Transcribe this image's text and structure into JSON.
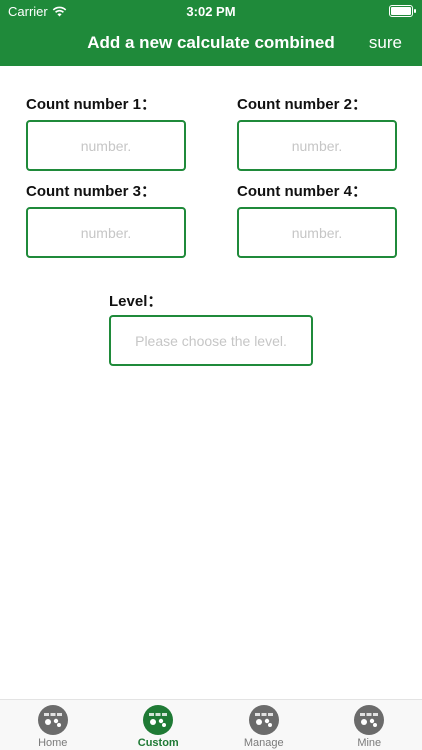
{
  "status_bar": {
    "carrier": "Carrier",
    "time": "3:02 PM"
  },
  "nav": {
    "title": "Add a new calculate combined",
    "sure_label": "sure"
  },
  "form": {
    "fields": [
      {
        "label": "Count number 1：",
        "placeholder": "number."
      },
      {
        "label": "Count number 2：",
        "placeholder": "number."
      },
      {
        "label": "Count number 3：",
        "placeholder": "number."
      },
      {
        "label": "Count number 4：",
        "placeholder": "number."
      }
    ],
    "level": {
      "label": "Level：",
      "placeholder": "Please choose the level."
    }
  },
  "tabs": [
    {
      "label": "Home",
      "icon": "mahjong-tiles-icon",
      "active": false
    },
    {
      "label": "Custom",
      "icon": "mahjong-tiles-icon",
      "active": true
    },
    {
      "label": "Manage",
      "icon": "mahjong-tiles-icon",
      "active": false
    },
    {
      "label": "Mine",
      "icon": "mahjong-tiles-icon",
      "active": false
    }
  ],
  "colors": {
    "brand": "#1f8a3a",
    "tab_active": "#1f7a35",
    "tab_inactive": "#6b6b6b"
  }
}
